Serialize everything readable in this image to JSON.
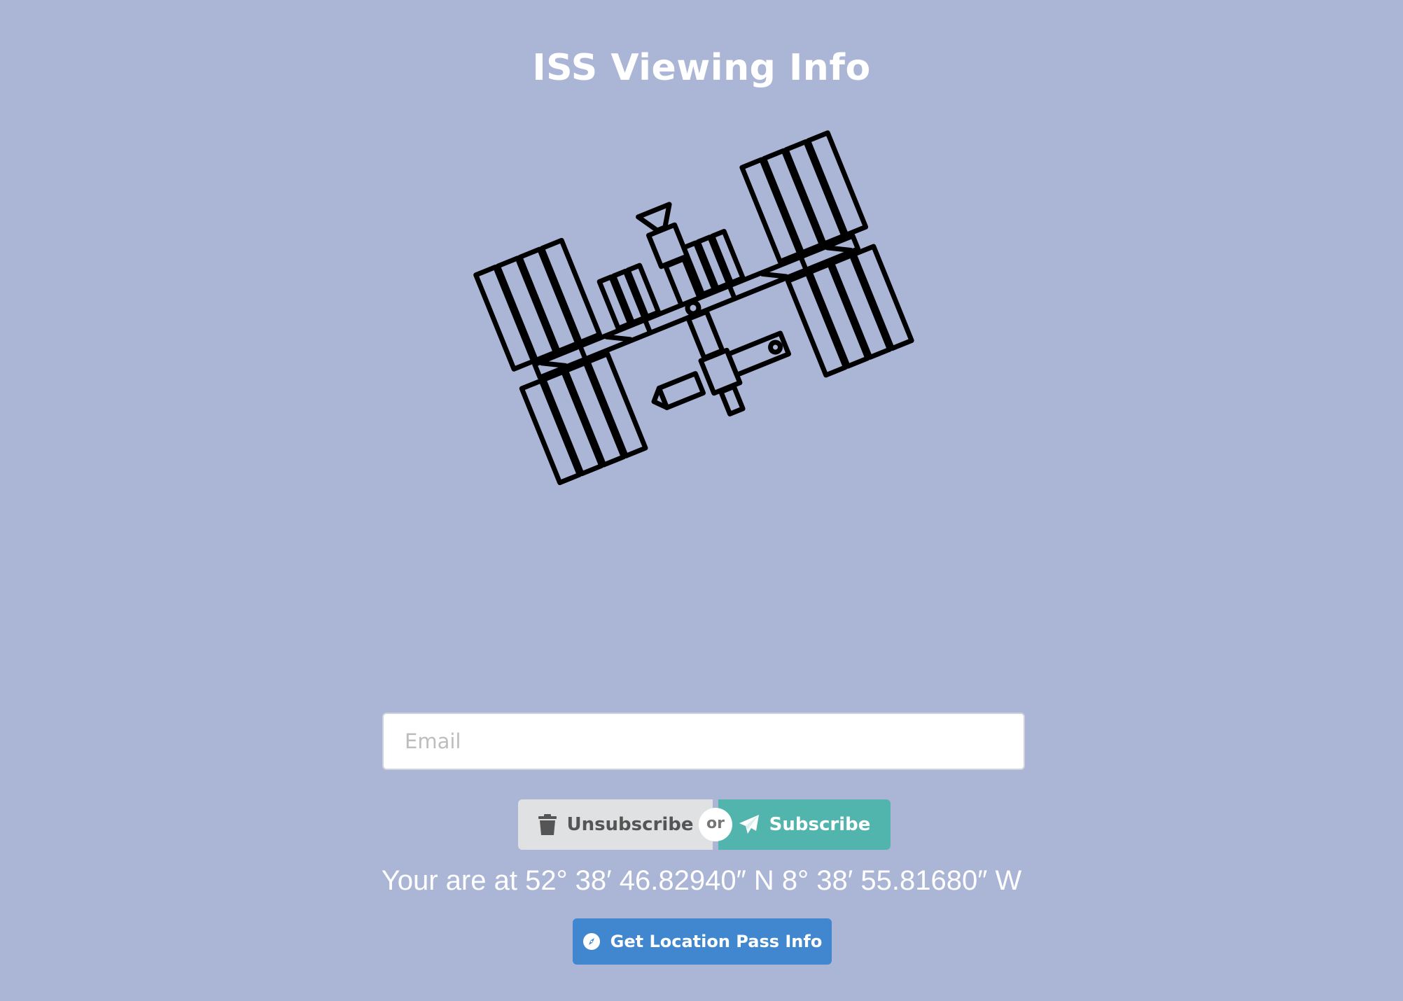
{
  "page": {
    "title": "ISS Viewing Info"
  },
  "illustration": {
    "icon": "space-station-icon"
  },
  "form": {
    "email_placeholder": "Email",
    "email_value": "",
    "unsubscribe_label": "Unsubscribe",
    "unsubscribe_icon": "trash-icon",
    "or_label": "or",
    "subscribe_label": "Subscribe",
    "subscribe_icon": "paper-plane-icon"
  },
  "location": {
    "text": "Your are at 52° 38′ 46.82940″ N 8° 38′ 55.81680″ W",
    "button_label": "Get Location Pass Info",
    "button_icon": "compass-icon"
  },
  "colors": {
    "background": "#abb6d6",
    "subscribe": "#52b5ad",
    "unsubscribe": "#e0e1e2",
    "location_button": "#4087cf"
  }
}
